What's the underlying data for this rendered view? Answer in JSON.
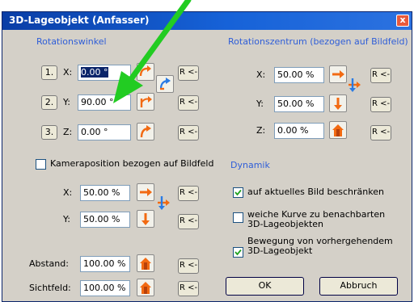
{
  "window": {
    "title": "3D-Lageobjekt (Anfasser)",
    "close_label": "x"
  },
  "rotation": {
    "heading": "Rotationswinkel",
    "rows": [
      {
        "num": "1.",
        "axis": "X:",
        "value": "0.00 °"
      },
      {
        "num": "2.",
        "axis": "Y:",
        "value": "90.00 °"
      },
      {
        "num": "3.",
        "axis": "Z:",
        "value": "0.00 °"
      }
    ],
    "reset_label": "R <-"
  },
  "center": {
    "heading": "Rotationszentrum (bezogen auf Bildfeld)",
    "rows": [
      {
        "axis": "X:",
        "value": "50.00 %"
      },
      {
        "axis": "Y:",
        "value": "50.00 %"
      },
      {
        "axis": "Z:",
        "value": "0.00 %"
      }
    ]
  },
  "camera": {
    "checkbox_label": "Kameraposition bezogen auf Bildfeld",
    "checked": false,
    "rows": [
      {
        "axis": "X:",
        "value": "50.00 %"
      },
      {
        "axis": "Y:",
        "value": "50.00 %"
      }
    ]
  },
  "dynamics": {
    "heading": "Dynamik",
    "options": [
      {
        "label": "auf aktuelles Bild beschränken",
        "checked": true
      },
      {
        "label": "weiche Kurve zu benachbarten 3D-Lageobjekten",
        "checked": false
      },
      {
        "label": "Bewegung von vorhergehendem 3D-Lageobjekt",
        "checked": true
      }
    ]
  },
  "distance": {
    "label": "Abstand:",
    "value": "100.00 %"
  },
  "fov": {
    "label": "Sichtfeld:",
    "value": "100.00 %"
  },
  "buttons": {
    "ok": "OK",
    "cancel": "Abbruch"
  },
  "colors": {
    "accent": "#2f5ed8",
    "icon_orange": "#f26a12",
    "annotation_arrow": "#22cc22"
  }
}
